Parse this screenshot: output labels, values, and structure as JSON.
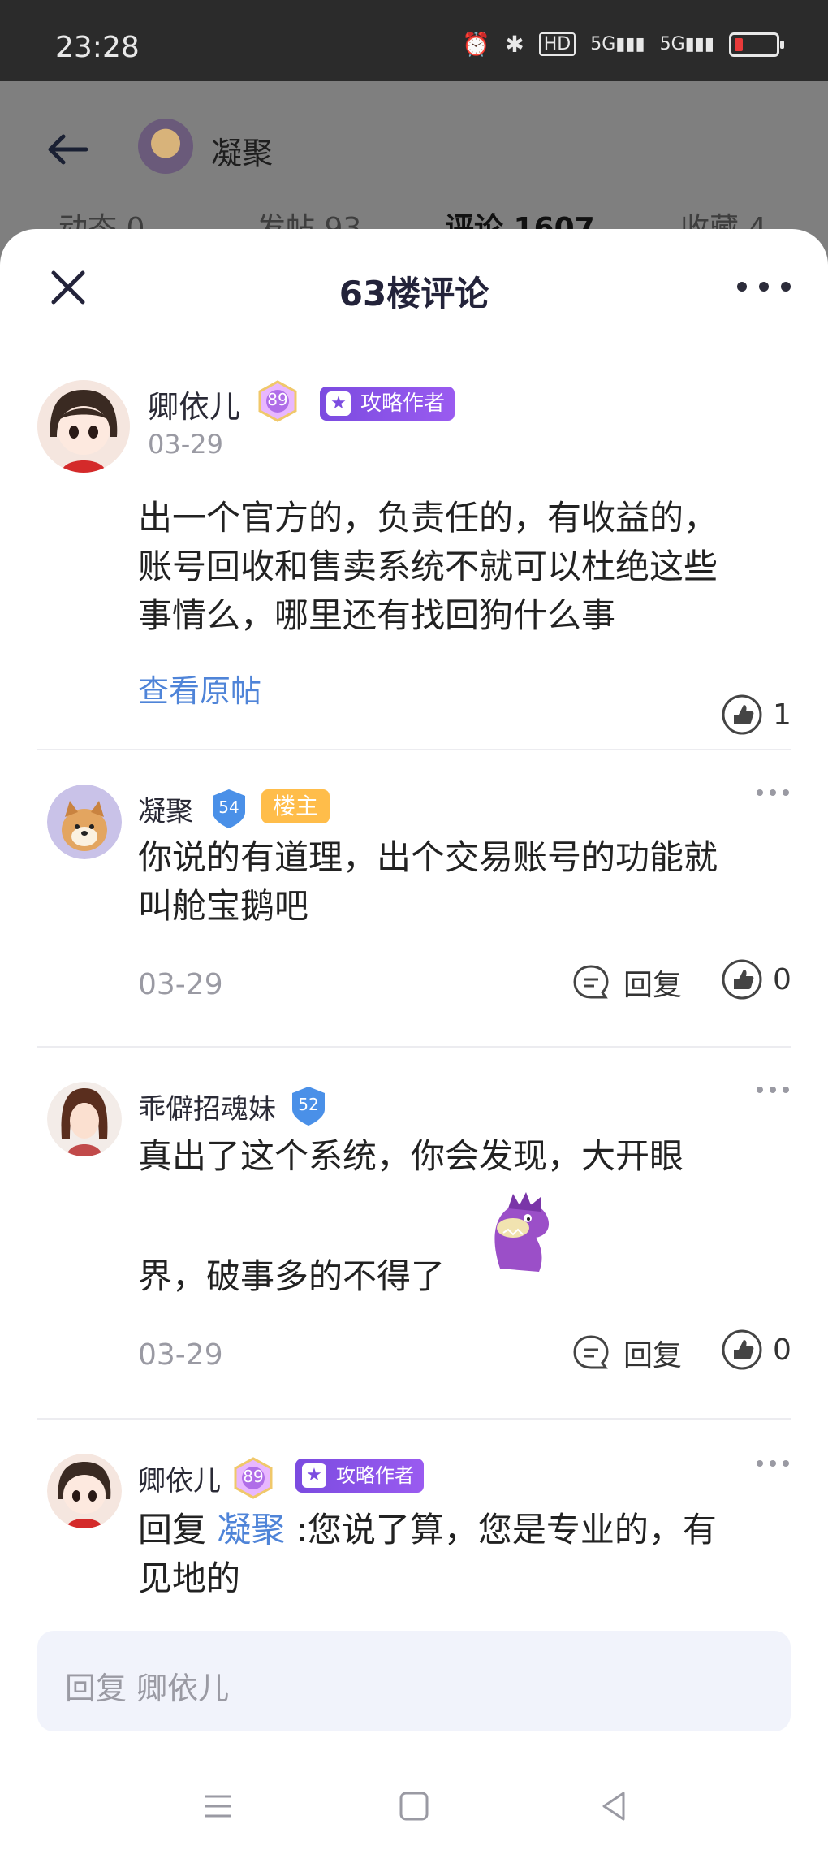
{
  "status_bar": {
    "time": "23:28",
    "icons": [
      "alarm-icon",
      "bluetooth-icon",
      "hd-icon",
      "5g-signal-icon",
      "5g-signal-icon",
      "battery-low-icon"
    ],
    "battery_color": "#e83a3a"
  },
  "profile_header": {
    "user_name": "凝聚",
    "tabs": [
      {
        "label": "动态 0"
      },
      {
        "label": "发帖 93"
      },
      {
        "label": "评论 1607"
      },
      {
        "label": "收藏 4"
      }
    ]
  },
  "sheet": {
    "title": "63楼评论",
    "main_comment": {
      "author": "卿依儿",
      "level": "89",
      "tag": "攻略作者",
      "date": "03-29",
      "lines": [
        "出一个官方的，负责任的，有收益的，",
        "账号回收和售卖系统不就可以杜绝这些",
        "事情么，哪里还有找回狗什么事"
      ],
      "view_original": "查看原帖",
      "likes": "1"
    },
    "replies": [
      {
        "author": "凝聚",
        "level": "54",
        "tag": "楼主",
        "lines": [
          "你说的有道理，出个交易账号的功能就",
          "叫舱宝鹅吧"
        ],
        "date": "03-29",
        "reply_label": "回复",
        "likes": "0"
      },
      {
        "author": "乖僻招魂妹",
        "level": "52",
        "lines": [
          "真出了这个系统，你会发现，大开眼",
          "界，破事多的不得了"
        ],
        "date": "03-29",
        "reply_label": "回复",
        "likes": "0"
      },
      {
        "author": "卿依儿",
        "level": "89",
        "tag": "攻略作者",
        "reply_prefix": "回复",
        "mention": "凝聚",
        "line1_rest": ":您说了算，您是专业的，有",
        "line2": "见地的"
      }
    ],
    "input_placeholder": "回复 卿依儿"
  },
  "nav_bar": {
    "icons": [
      "menu-icon",
      "home-icon",
      "back-icon"
    ]
  }
}
